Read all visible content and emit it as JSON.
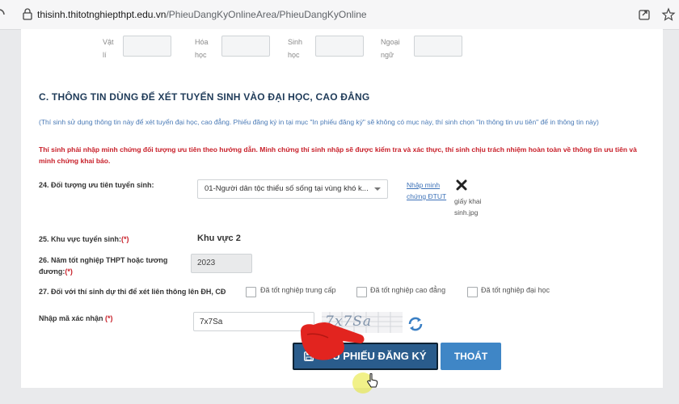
{
  "browser": {
    "url_host": "thisinh.thitotnghiepthpt.edu.vn",
    "url_path": "/PhieuDangKyOnlineArea/PhieuDangKyOnline"
  },
  "subjects": [
    {
      "l1": "Vật",
      "l2": "lí"
    },
    {
      "l1": "Hóa",
      "l2": "học"
    },
    {
      "l1": "Sinh",
      "l2": "học"
    },
    {
      "l1": "Ngoại",
      "l2": "ngữ"
    }
  ],
  "section": {
    "title": "C. THÔNG TIN DÙNG ĐỂ XÉT TUYỂN SINH VÀO ĐẠI HỌC, CAO ĐẲNG",
    "note_blue": "(Thí sinh sử dụng thông tin này để xét tuyển đại học, cao đẳng. Phiếu đăng ký in tại mục \"In phiếu đăng ký\" sẽ không có mục này, thí sinh chọn \"In thông tin ưu tiên\" để in thông tin này)",
    "note_red": "Thí sinh phải nhập minh chứng đối tượng ưu tiên theo hướng dẫn. Minh chứng thí sinh nhập sẽ được kiểm tra và xác thực, thí sinh chịu trách nhiệm hoàn toàn về thông tin ưu tiên và minh chứng khai báo."
  },
  "q24": {
    "label": "24. Đối tượng ưu tiên tuyển sinh:",
    "value": "01-Người dân tộc thiểu số sống tại vùng khó k...",
    "link": "Nhập minh chứng ĐTUT",
    "file": "giấy khai sinh.jpg"
  },
  "q25": {
    "label": "25. Khu vực tuyển sinh:",
    "req": "(*)",
    "value": "Khu vực 2"
  },
  "q26": {
    "label": "26. Năm tốt nghiệp THPT hoặc tương đương:",
    "req": "(*)",
    "value": "2023"
  },
  "q27": {
    "label": "27. Đối với thí sinh dự thi để xét liên thông lên ĐH, CĐ",
    "options": [
      "Đã tốt nghiệp trung cấp",
      "Đã tốt nghiệp cao đẳng",
      "Đã tốt nghiệp đại học"
    ]
  },
  "captcha": {
    "label": "Nhập mã xác nhận",
    "req": "(*)",
    "value": "7x7Sa",
    "image_text": "7x7Sa"
  },
  "buttons": {
    "save": "LƯU PHIẾU ĐĂNG KÝ",
    "exit": "THOÁT"
  },
  "colors": {
    "save_bg": "#2a5c8c",
    "exit_bg": "#3f86c6",
    "title": "#1f3b59",
    "note_blue": "#4a7ab6",
    "note_red": "#c8202a"
  }
}
